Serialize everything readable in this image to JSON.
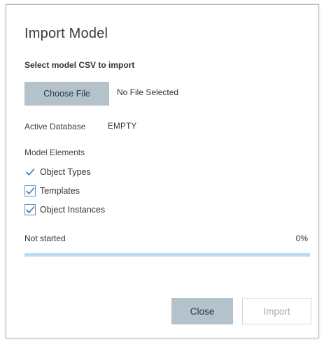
{
  "dialog": {
    "title": "Import Model",
    "subtitle": "Select model CSV to import"
  },
  "file": {
    "choose_label": "Choose File",
    "status": "No File Selected"
  },
  "database": {
    "label": "Active Database",
    "value": "EMPTY"
  },
  "elements": {
    "label": "Model Elements",
    "items": [
      {
        "label": "Object Types",
        "checked": true
      },
      {
        "label": "Templates",
        "checked": true
      },
      {
        "label": "Object Instances",
        "checked": true
      }
    ]
  },
  "progress": {
    "status": "Not started",
    "percent_label": "0%",
    "fraction": 0
  },
  "footer": {
    "close_label": "Close",
    "import_label": "Import"
  },
  "colors": {
    "primary_button_bg": "#b4c2cc",
    "progress_track": "#bcdcf1",
    "checkbox_border": "#6f8fb0",
    "check_mark": "#3f78b5"
  }
}
